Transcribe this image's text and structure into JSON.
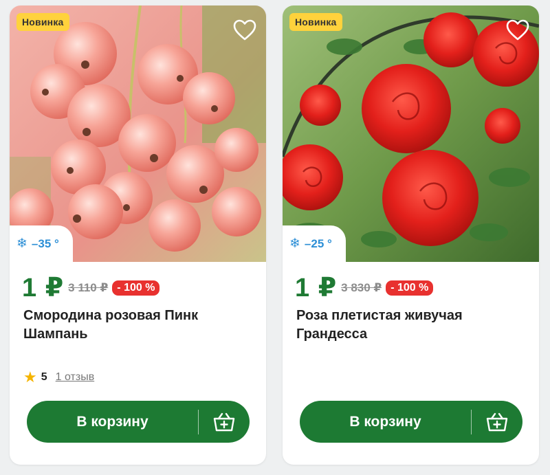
{
  "products": [
    {
      "badge": "Новинка",
      "frost": "–35 °",
      "price_now": "1 ₽",
      "price_old": "3 110 ₽",
      "discount": "- 100 %",
      "title": "Смородина розовая Пинк Шампань",
      "rating": "5",
      "reviews": "1 отзыв",
      "cart_label": "В корзину"
    },
    {
      "badge": "Новинка",
      "frost": "–25 °",
      "price_now": "1 ₽",
      "price_old": "3 830 ₽",
      "discount": "- 100 %",
      "title": "Роза плетистая живучая Грандесса",
      "cart_label": "В корзину"
    }
  ],
  "icons": {
    "favorite": "heart-icon",
    "frost": "snowflake-icon",
    "star": "star-icon",
    "cart": "basket-plus-icon"
  },
  "colors": {
    "accent_green": "#1d7a33",
    "price_green": "#1f7a34",
    "badge_yellow": "#ffd23c",
    "discount_red": "#e8312f",
    "frost_blue": "#2d8fd6"
  }
}
